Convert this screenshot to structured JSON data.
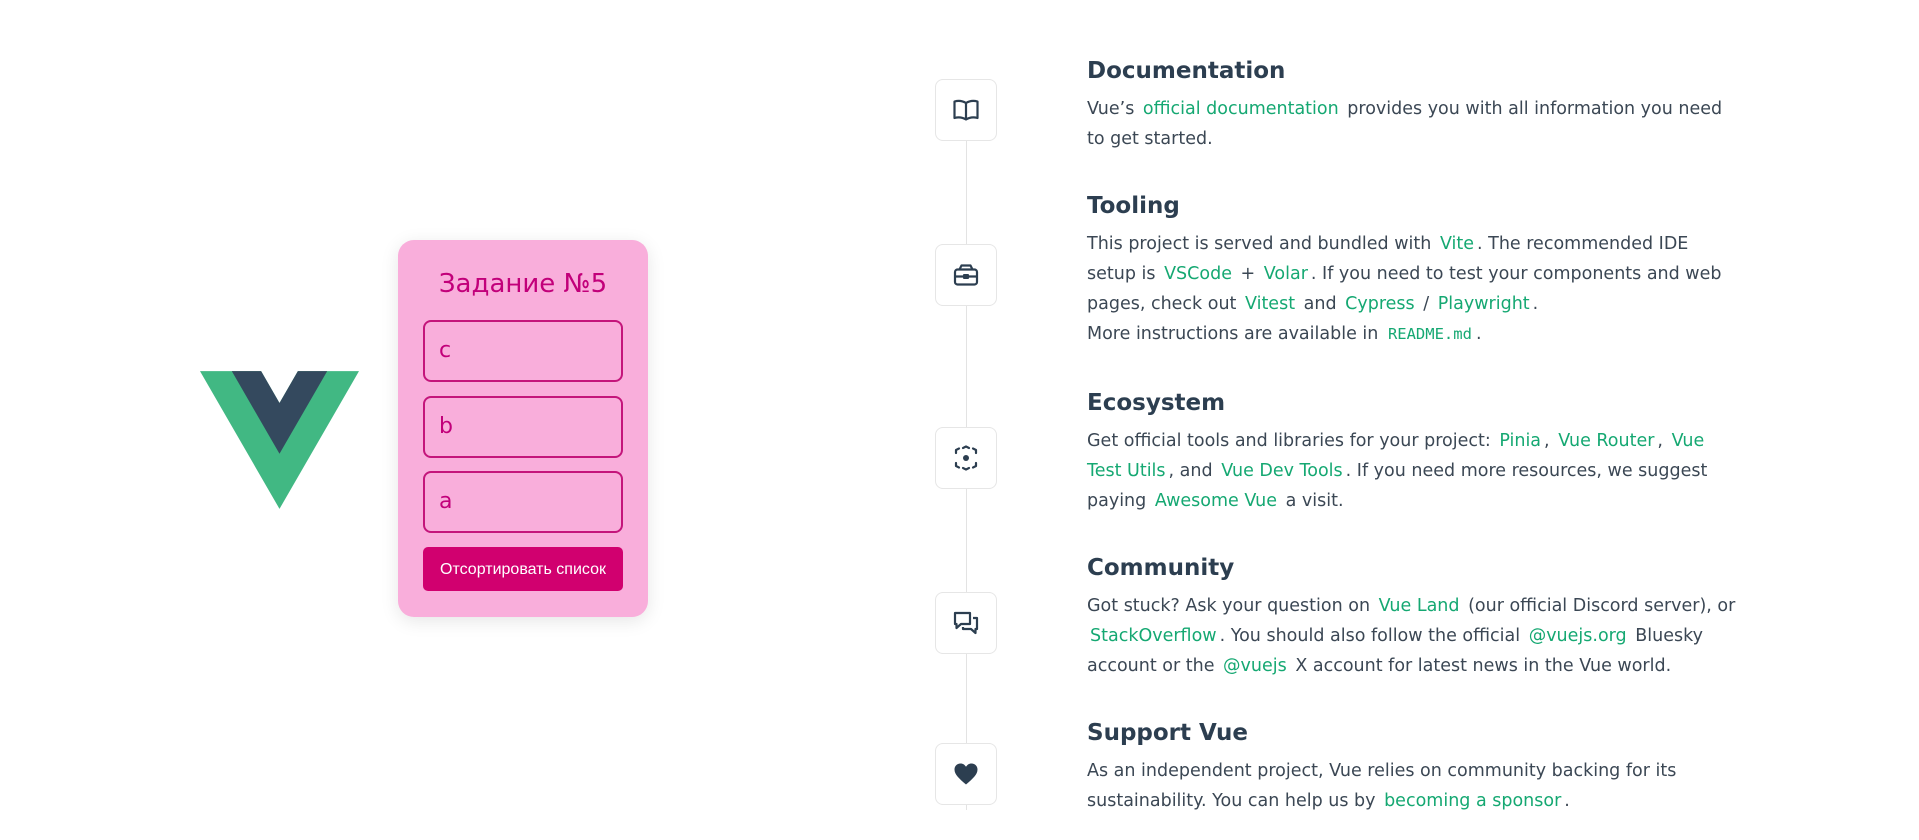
{
  "task": {
    "title": "Задание №5",
    "items": [
      "c",
      "b",
      "a"
    ],
    "button_label": "Отсортировать список"
  },
  "sections": {
    "documentation": {
      "icon": "book-icon",
      "title": "Documentation",
      "t1": "Vue’s",
      "link1": "official documentation",
      "t2": "provides you with all information you need to get started."
    },
    "tooling": {
      "icon": "toolbox-icon",
      "title": "Tooling",
      "t1": "This project is served and bundled with",
      "link_vite": "Vite",
      "t2": ". The recommended IDE setup is",
      "link_vscode": "VSCode",
      "t3": "+",
      "link_volar": "Volar",
      "t4": ". If you need to test your components and web pages, check out",
      "link_vitest": "Vitest",
      "t5": "and",
      "link_cypress": "Cypress",
      "t6": "/",
      "link_playwright": "Playwright",
      "t7": ".",
      "t8": "More instructions are available in",
      "code_readme": "README.md",
      "t9": "."
    },
    "ecosystem": {
      "icon": "ecosystem-icon",
      "title": "Ecosystem",
      "t1": "Get official tools and libraries for your project:",
      "link_pinia": "Pinia",
      "t2": ",",
      "link_router": "Vue Router",
      "t3": ",",
      "link_testutils": "Vue Test Utils",
      "t4": ", and",
      "link_devtools": "Vue Dev Tools",
      "t5": ". If you need more resources, we suggest paying",
      "link_awesome": "Awesome Vue",
      "t6": "a visit."
    },
    "community": {
      "icon": "chat-icon",
      "title": "Community",
      "t1": "Got stuck? Ask your question on",
      "link_vueland": "Vue Land",
      "t2": "(our official Discord server), or",
      "link_stackoverflow": "StackOverflow",
      "t3": ". You should also follow the official",
      "link_bluesky": "@vuejs.org",
      "t4": "Bluesky account or the",
      "link_x": "@vuejs",
      "t5": "X account for latest news in the Vue world."
    },
    "support": {
      "icon": "heart-icon",
      "title": "Support Vue",
      "t1": "As an independent project, Vue relies on community backing for its sustainability. You can help us by",
      "link_sponsor": "becoming a sponsor",
      "t2": "."
    }
  },
  "colors": {
    "link": "#15a872",
    "heading": "#2c3e50",
    "card_bg": "#f9aedb",
    "card_accent": "#c2007a",
    "button_bg": "#d1006f",
    "vue_green": "#41b883",
    "vue_dark": "#35495e"
  }
}
